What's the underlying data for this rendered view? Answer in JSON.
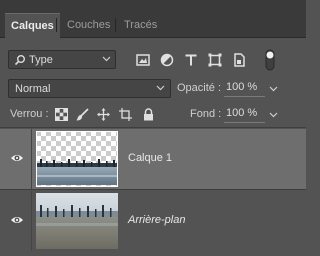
{
  "tabs": [
    {
      "label": "Calques",
      "active": true
    },
    {
      "label": "Couches",
      "active": false
    },
    {
      "label": "Tracés",
      "active": false
    }
  ],
  "filter": {
    "label": "Type",
    "icons": [
      "image-filter-icon",
      "adjustment-filter-icon",
      "type-filter-icon",
      "shape-filter-icon",
      "smart-object-filter-icon",
      "filter-toggle-icon"
    ]
  },
  "blend": {
    "mode": "Normal",
    "opacity_label": "Opacité :",
    "opacity_value": "100 %"
  },
  "lock": {
    "label": "Verrou :",
    "icons": [
      "lock-transparent-pixels-icon",
      "lock-image-pixels-icon",
      "lock-position-icon",
      "lock-artboard-icon",
      "lock-all-icon"
    ],
    "fill_label": "Fond :",
    "fill_value": "100 %"
  },
  "layers": [
    {
      "name": "Calque 1",
      "visible": true,
      "selected": true
    },
    {
      "name": "Arrière-plan",
      "visible": true,
      "selected": false
    }
  ],
  "colors": {
    "panel": "#535353",
    "tabbar": "#3a3a3a",
    "selected_row": "#6e6e6e"
  }
}
